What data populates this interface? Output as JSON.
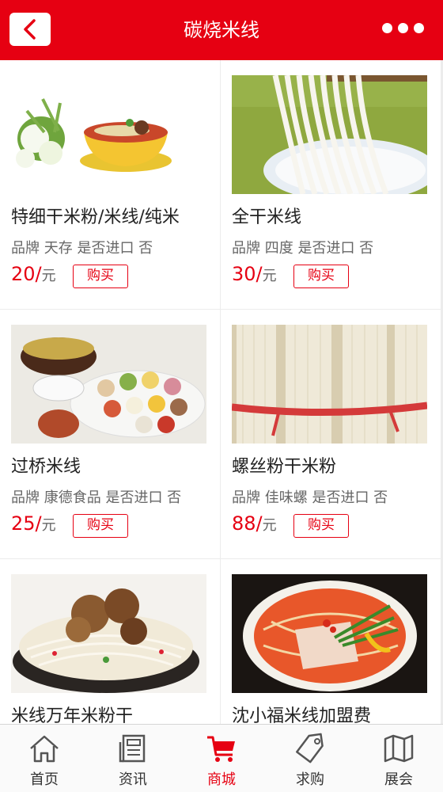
{
  "header": {
    "title": "碳烧米线",
    "back_icon": "chevron-left-icon",
    "more_icon": "more-dots-icon"
  },
  "products": [
    {
      "name": "特细干米粉/米线/纯米",
      "meta": "品牌 天存 是否进口 否",
      "price": "20/",
      "unit": "元",
      "buy_label": "购买",
      "image": "noodle-bowl-flowers"
    },
    {
      "name": "全干米线",
      "meta": "品牌 四度 是否进口 否",
      "price": "30/",
      "unit": "元",
      "buy_label": "购买",
      "image": "noodles-lifted-chopsticks"
    },
    {
      "name": "过桥米线",
      "meta": "品牌 康德食品 是否进口 否",
      "price": "25/",
      "unit": "元",
      "buy_label": "购买",
      "image": "crossing-bridge-noodles-set"
    },
    {
      "name": "螺丝粉干米粉",
      "meta": "品牌 佳味螺 是否进口 否",
      "price": "88/",
      "unit": "元",
      "buy_label": "购买",
      "image": "dried-rice-noodle-bundles"
    },
    {
      "name": "米线万年米粉干",
      "meta": "",
      "price": "",
      "unit": "",
      "buy_label": "",
      "image": "beef-noodle-bowl"
    },
    {
      "name": "沈小福米线加盟费",
      "meta": "",
      "price": "",
      "unit": "",
      "buy_label": "",
      "image": "spicy-noodle-bowl"
    }
  ],
  "nav": [
    {
      "label": "首页",
      "icon": "home-icon",
      "active": false
    },
    {
      "label": "资讯",
      "icon": "news-icon",
      "active": false
    },
    {
      "label": "商城",
      "icon": "cart-icon",
      "active": true
    },
    {
      "label": "求购",
      "icon": "tag-icon",
      "active": false
    },
    {
      "label": "展会",
      "icon": "map-icon",
      "active": false
    }
  ],
  "colors": {
    "brand": "#e60012",
    "background": "#ececec"
  }
}
